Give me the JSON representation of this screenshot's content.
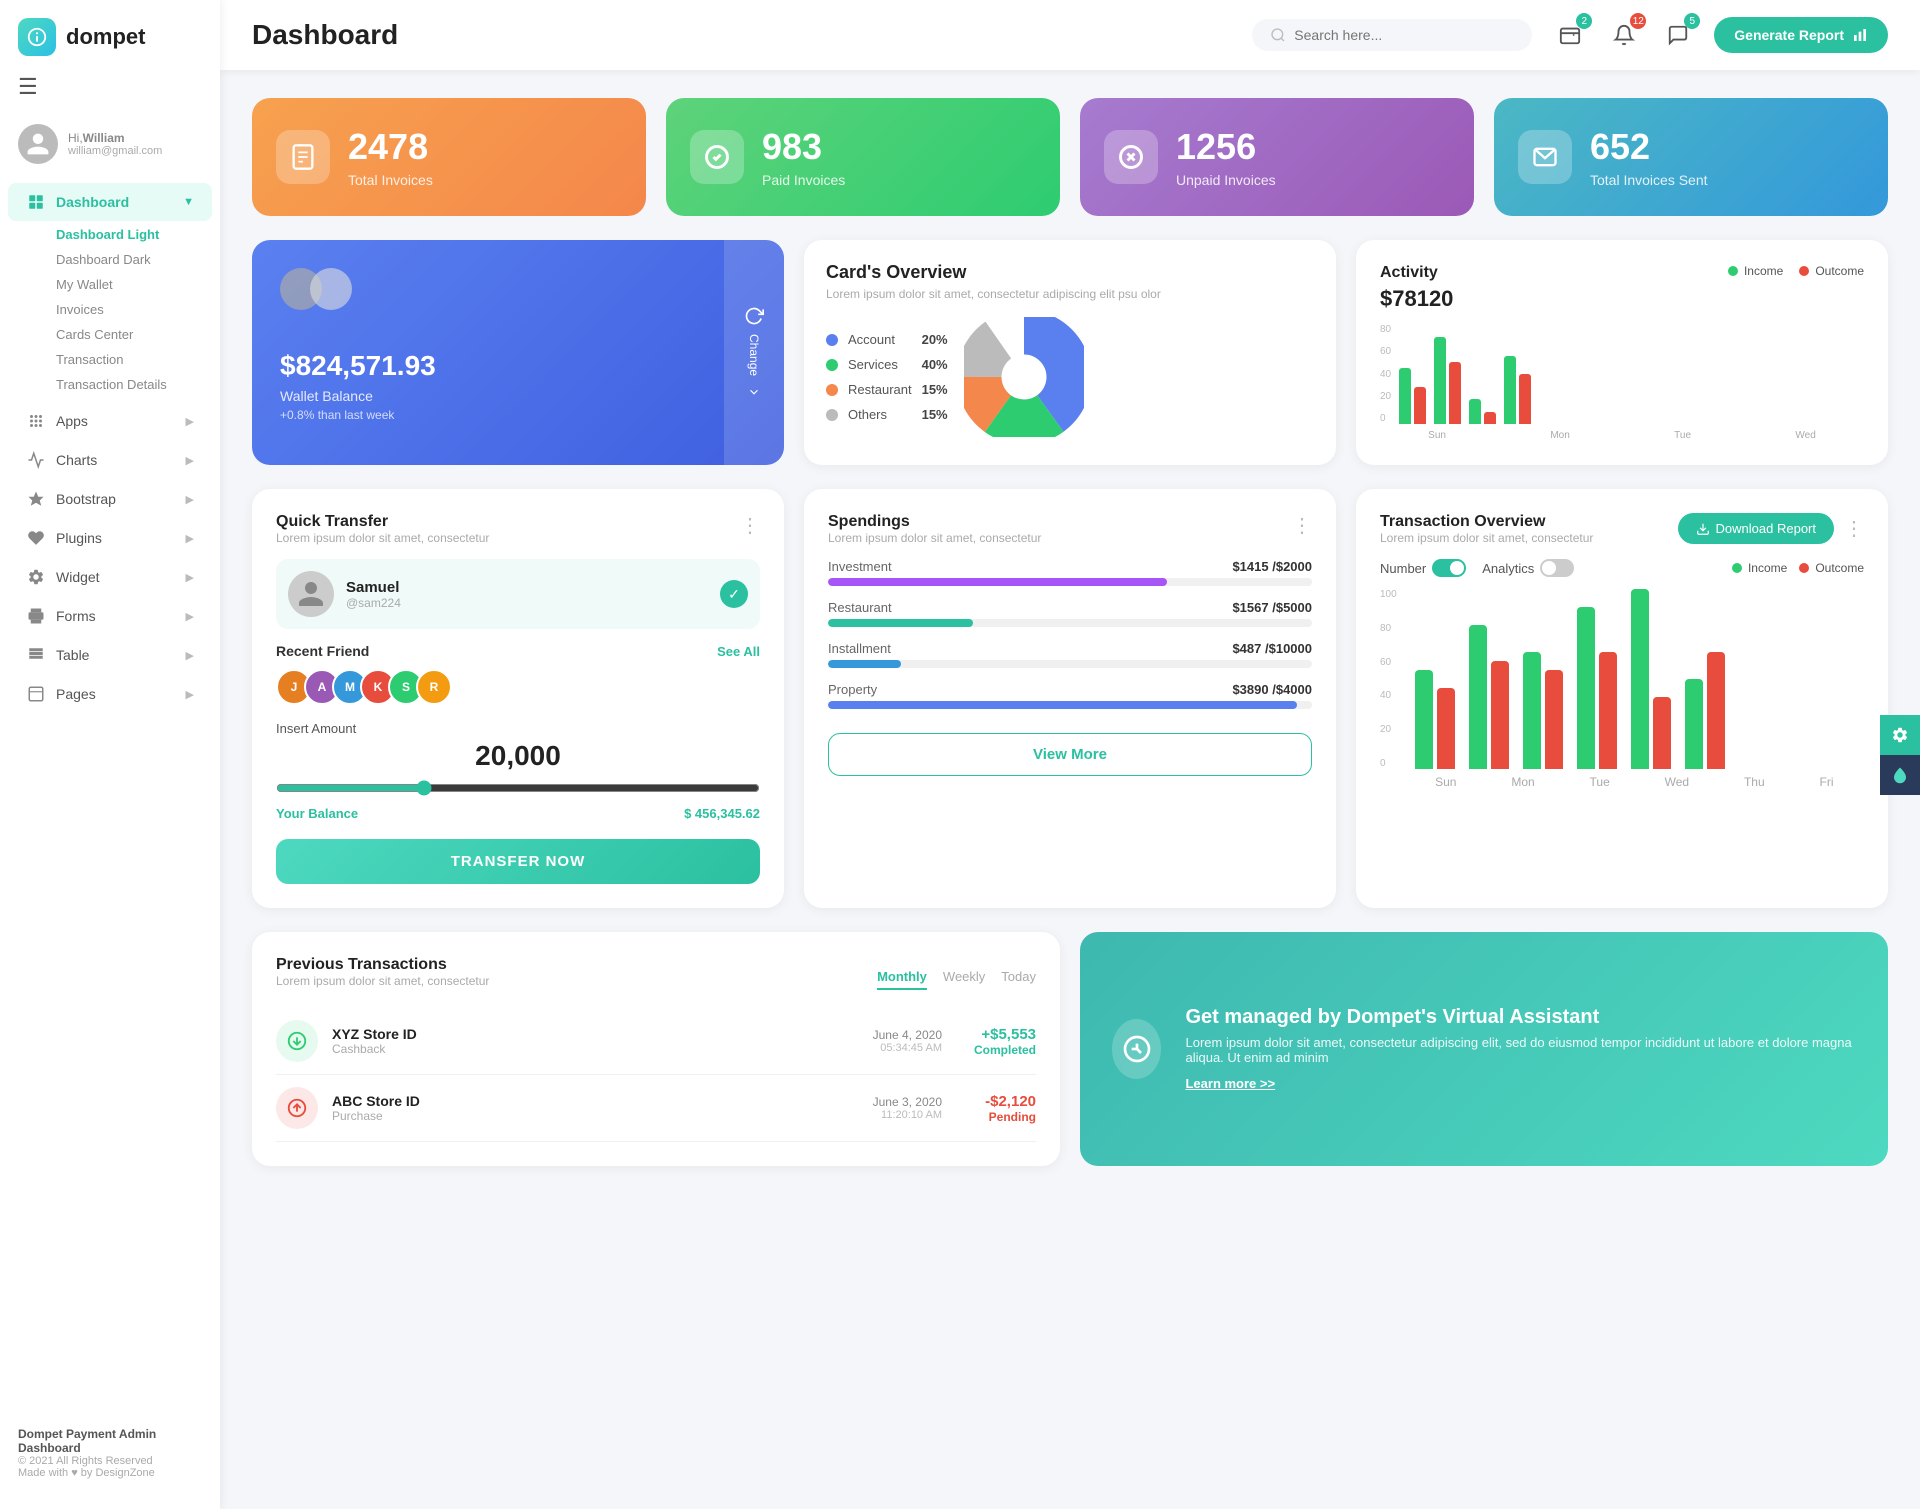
{
  "app": {
    "name": "dompet",
    "title": "Dashboard"
  },
  "header": {
    "title": "Dashboard",
    "search_placeholder": "Search here...",
    "generate_btn": "Generate Report",
    "badges": {
      "wallet": "2",
      "bell": "12",
      "chat": "5"
    }
  },
  "user": {
    "greeting": "Hi,",
    "name": "William",
    "email": "william@gmail.com"
  },
  "sidebar": {
    "main_items": [
      {
        "id": "dashboard",
        "label": "Dashboard",
        "icon": "grid",
        "active": true,
        "arrow": true
      },
      {
        "id": "apps",
        "label": "Apps",
        "icon": "apps",
        "arrow": true
      },
      {
        "id": "charts",
        "label": "Charts",
        "icon": "chart",
        "arrow": true
      },
      {
        "id": "bootstrap",
        "label": "Bootstrap",
        "icon": "star",
        "arrow": true
      },
      {
        "id": "plugins",
        "label": "Plugins",
        "icon": "heart",
        "arrow": true
      },
      {
        "id": "widget",
        "label": "Widget",
        "icon": "gear",
        "arrow": true
      },
      {
        "id": "forms",
        "label": "Forms",
        "icon": "printer",
        "arrow": true
      },
      {
        "id": "table",
        "label": "Table",
        "icon": "table",
        "arrow": true
      },
      {
        "id": "pages",
        "label": "Pages",
        "icon": "pages",
        "arrow": true
      }
    ],
    "sub_items": [
      {
        "label": "Dashboard Light",
        "active": true
      },
      {
        "label": "Dashboard Dark"
      },
      {
        "label": "My Wallet"
      },
      {
        "label": "Invoices"
      },
      {
        "label": "Cards Center"
      },
      {
        "label": "Transaction"
      },
      {
        "label": "Transaction Details"
      }
    ],
    "footer": {
      "brand": "Dompet Payment Admin Dashboard",
      "copy": "© 2021 All Rights Reserved",
      "made_with": "Made with ♥ by DesignZone"
    }
  },
  "stats": [
    {
      "id": "total",
      "num": "2478",
      "label": "Total Invoices",
      "color": "orange"
    },
    {
      "id": "paid",
      "num": "983",
      "label": "Paid Invoices",
      "color": "green"
    },
    {
      "id": "unpaid",
      "num": "1256",
      "label": "Unpaid Invoices",
      "color": "purple"
    },
    {
      "id": "sent",
      "num": "652",
      "label": "Total Invoices Sent",
      "color": "teal"
    }
  ],
  "wallet": {
    "balance": "$824,571.93",
    "label": "Wallet Balance",
    "change": "+0.8% than last week",
    "change_btn": "Change"
  },
  "cards_overview": {
    "title": "Card's Overview",
    "subtitle": "Lorem ipsum dolor sit amet, consectetur adipiscing elit psu olor",
    "items": [
      {
        "label": "Account",
        "pct": "20%",
        "color": "#5a80f0"
      },
      {
        "label": "Services",
        "pct": "40%",
        "color": "#2ecc71"
      },
      {
        "label": "Restaurant",
        "pct": "15%",
        "color": "#f4874b"
      },
      {
        "label": "Others",
        "pct": "15%",
        "color": "#bbb"
      }
    ]
  },
  "activity": {
    "title": "Activity",
    "amount": "$78120",
    "legend": [
      {
        "label": "Income",
        "color": "#2ecc71"
      },
      {
        "label": "Outcome",
        "color": "#e74c3c"
      }
    ],
    "bars": [
      {
        "day": "Sun",
        "income": 45,
        "outcome": 30
      },
      {
        "day": "Mon",
        "income": 70,
        "outcome": 50
      },
      {
        "day": "Tue",
        "income": 20,
        "outcome": 10
      },
      {
        "day": "Wed",
        "income": 55,
        "outcome": 40
      }
    ],
    "y_labels": [
      "0",
      "20",
      "40",
      "60",
      "80"
    ]
  },
  "quick_transfer": {
    "title": "Quick Transfer",
    "subtitle": "Lorem ipsum dolor sit amet, consectetur",
    "user": {
      "name": "Samuel",
      "handle": "@sam224"
    },
    "recent_label": "Recent Friend",
    "see_all": "See All",
    "friends": [
      {
        "color": "#e67e22",
        "letter": "J"
      },
      {
        "color": "#9b59b6",
        "letter": "A"
      },
      {
        "color": "#3498db",
        "letter": "M"
      },
      {
        "color": "#e74c3c",
        "letter": "K"
      },
      {
        "color": "#2ecc71",
        "letter": "S"
      },
      {
        "color": "#f39c12",
        "letter": "R"
      }
    ],
    "amount_label": "Insert Amount",
    "amount": "20,000",
    "your_balance": "Your Balance",
    "balance_value": "$ 456,345.62",
    "transfer_btn": "TRANSFER NOW"
  },
  "spendings": {
    "title": "Spendings",
    "subtitle": "Lorem ipsum dolor sit amet, consectetur",
    "items": [
      {
        "label": "Investment",
        "amount": "$1415",
        "total": "$2000",
        "pct": 70,
        "color": "#a855f7"
      },
      {
        "label": "Restaurant",
        "amount": "$1567",
        "total": "$5000",
        "pct": 30,
        "color": "#2bc0a0"
      },
      {
        "label": "Installment",
        "amount": "$487",
        "total": "$10000",
        "pct": 15,
        "color": "#3498db"
      },
      {
        "label": "Property",
        "amount": "$3890",
        "total": "$4000",
        "pct": 97,
        "color": "#5a80f0"
      }
    ],
    "view_more_btn": "View More"
  },
  "transaction_overview": {
    "title": "Transaction Overview",
    "subtitle": "Lorem ipsum dolor sit amet, consectetur",
    "download_btn": "Download Report",
    "toggles": [
      {
        "label": "Number",
        "active": true
      },
      {
        "label": "Analytics",
        "active": false
      }
    ],
    "legend": [
      {
        "label": "Income",
        "color": "#2ecc71"
      },
      {
        "label": "Outcome",
        "color": "#e74c3c"
      }
    ],
    "bars": [
      {
        "day": "Sun",
        "income": 55,
        "outcome": 45
      },
      {
        "day": "Mon",
        "income": 80,
        "outcome": 60
      },
      {
        "day": "Tue",
        "income": 65,
        "outcome": 55
      },
      {
        "day": "Wed",
        "income": 90,
        "outcome": 65
      },
      {
        "day": "Thu",
        "income": 100,
        "outcome": 40
      },
      {
        "day": "Fri",
        "income": 50,
        "outcome": 65
      }
    ],
    "y_labels": [
      "0",
      "20",
      "40",
      "60",
      "80",
      "100"
    ]
  },
  "prev_transactions": {
    "title": "Previous Transactions",
    "subtitle": "Lorem ipsum dolor sit amet, consectetur",
    "tabs": [
      {
        "label": "Monthly",
        "active": true
      },
      {
        "label": "Weekly"
      },
      {
        "label": "Today"
      }
    ],
    "items": [
      {
        "icon_type": "green",
        "name": "XYZ Store ID",
        "type": "Cashback",
        "date": "June 4, 2020",
        "time": "05:34:45 AM",
        "amount": "+$5,553",
        "status": "Completed",
        "positive": true
      }
    ]
  },
  "virtual_assistant": {
    "title": "Get managed by Dompet's Virtual Assistant",
    "subtitle": "Lorem ipsum dolor sit amet, consectetur adipiscing elit, sed do eiusmod tempor incididunt ut labore et dolore magna aliqua. Ut enim ad minim",
    "link": "Learn more >>"
  }
}
